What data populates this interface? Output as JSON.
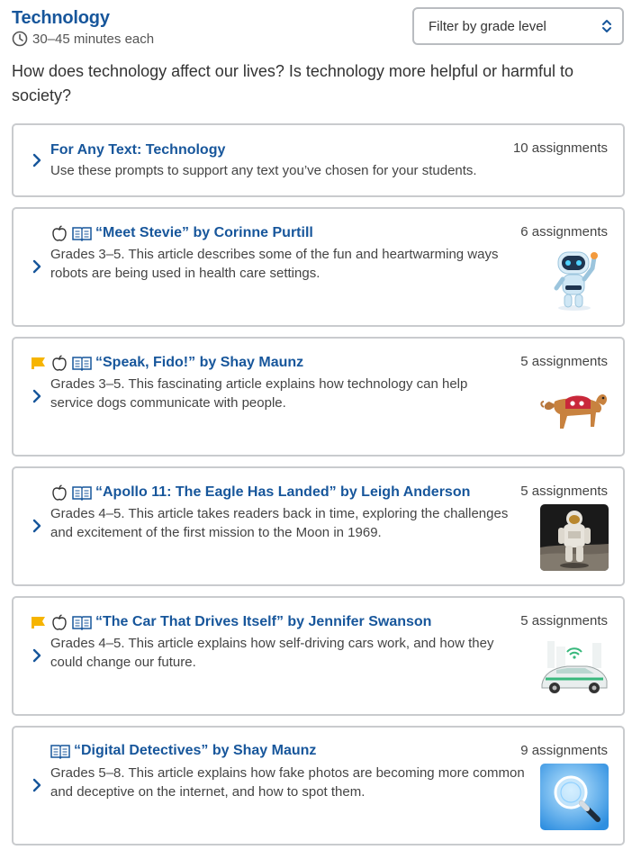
{
  "header": {
    "title": "Technology",
    "duration": "30–45 minutes each"
  },
  "filter": {
    "label": "Filter by grade level"
  },
  "intro": "How does technology affect our lives? Is technology more helpful or harmful to society?",
  "cards": [
    {
      "title": "For Any Text: Technology",
      "description": "Use these prompts to support any text you’ve chosen for your students.",
      "count": "10 assignments",
      "icons": []
    },
    {
      "title": "“Meet Stevie” by Corinne Purtill",
      "description": "Grades 3–5. This article describes some of the fun and heartwarming ways robots are being used in health care settings.",
      "count": "6 assignments",
      "icons": [
        "apple-icon",
        "book-icon"
      ],
      "thumbnail": "robot-thumbnail"
    },
    {
      "title": "“Speak, Fido!” by Shay Maunz",
      "description": "Grades 3–5. This fascinating article explains how technology can help service dogs communicate with people.",
      "count": "5 assignments",
      "icons": [
        "flag-icon",
        "apple-icon",
        "book-icon"
      ],
      "thumbnail": "dog-thumbnail"
    },
    {
      "title": "“Apollo 11: The Eagle Has Landed” by Leigh Anderson",
      "description": "Grades 4–5. This article takes readers back in time, exploring the challenges and excitement of the first mission to the Moon in 1969.",
      "count": "5 assignments",
      "icons": [
        "apple-icon",
        "book-icon"
      ],
      "thumbnail": "astronaut-thumbnail"
    },
    {
      "title": "“The Car That Drives Itself” by Jennifer Swanson",
      "description": "Grades 4–5. This article explains how self-driving cars work, and how they could change our future.",
      "count": "5 assignments",
      "icons": [
        "flag-icon",
        "apple-icon",
        "book-icon"
      ],
      "thumbnail": "car-thumbnail"
    },
    {
      "title": "“Digital Detectives” by Shay Maunz",
      "description": "Grades 5–8. This article explains how fake photos are becoming more common and deceptive on the internet, and how to spot them.",
      "count": "9 assignments",
      "icons": [
        "book-icon"
      ],
      "thumbnail": "magnifier-thumbnail"
    }
  ],
  "colors": {
    "accent": "#17569b",
    "flag": "#f6b400",
    "border": "#c9cbce"
  }
}
